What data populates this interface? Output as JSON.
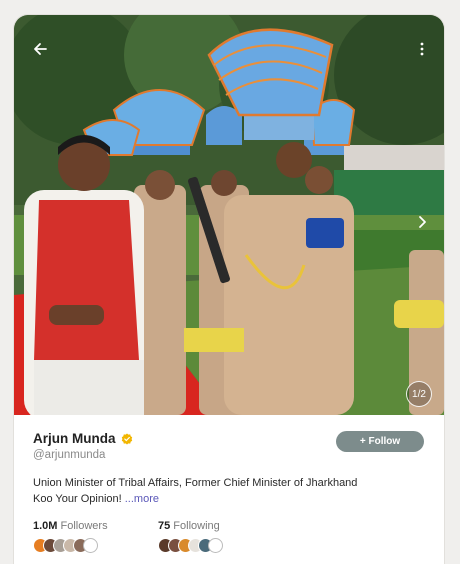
{
  "post": {
    "image_alt": "Man in red Nehru jacket standing with uniformed guard of honour wearing blue fan turbans",
    "counter": "1/2"
  },
  "profile": {
    "name": "Arjun Munda",
    "handle": "@arjunmunda",
    "follow_label": "+ Follow",
    "bio_line1": "Union Minister of Tribal Affairs, Former Chief Minister of Jharkhand",
    "bio_line2": "Koo Your Opinion! ",
    "bio_more": "...more",
    "followers_count": "1.0M",
    "followers_label": " Followers",
    "following_count": "75",
    "following_label": " Following"
  },
  "icons": {
    "back": "arrow-left-icon",
    "menu": "more-vertical-icon",
    "next": "chevron-right-icon",
    "verified": "verified-badge-icon"
  },
  "colors": {
    "follow_button": "#7d8c8c",
    "more_link": "#5a57b8",
    "verified": "#f2b600"
  }
}
